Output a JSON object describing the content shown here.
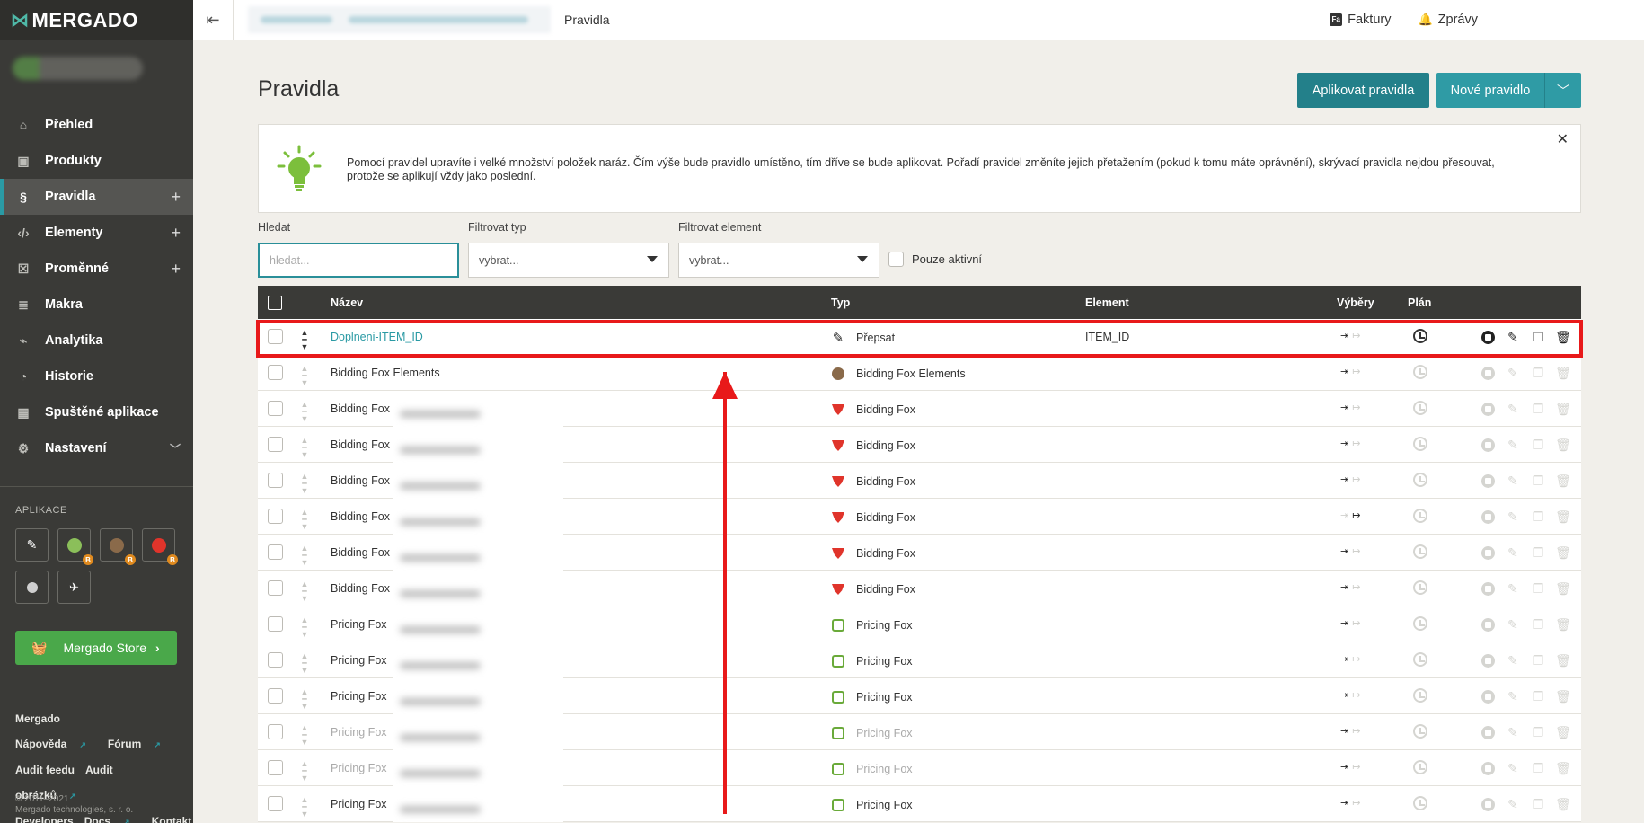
{
  "brand": {
    "logo_text": "MERGADO"
  },
  "sidebar": {
    "items": [
      {
        "label": "Přehled",
        "icon": "home-icon"
      },
      {
        "label": "Produkty",
        "icon": "box-icon"
      },
      {
        "label": "Pravidla",
        "icon": "section-icon",
        "active": true,
        "plus": "+"
      },
      {
        "label": "Elementy",
        "icon": "code-icon",
        "plus": "+"
      },
      {
        "label": "Proměnné",
        "icon": "variable-icon",
        "plus": "+"
      },
      {
        "label": "Makra",
        "icon": "macro-icon"
      },
      {
        "label": "Analytika",
        "icon": "chart-icon"
      },
      {
        "label": "Historie",
        "icon": "history-icon"
      },
      {
        "label": "Spuštěné aplikace",
        "icon": "apps-grid-icon"
      },
      {
        "label": "Nastavení",
        "icon": "gear-icon"
      }
    ],
    "apps_title": "APLIKACE",
    "store_label": "Mergado Store",
    "footer": {
      "mergado": "Mergado",
      "napoveda": "Nápověda",
      "forum": "Fórum",
      "audit_feedu": "Audit feedu",
      "audit_obrazku": "Audit obrázků",
      "developers": "Developers",
      "docs": "Docs",
      "kontakt": "Kontakt",
      "copy1": "© 2011–2021",
      "copy2": "Mergado technologies, s. r. o."
    }
  },
  "topbar": {
    "title": "Pravidla",
    "faktury": "Faktury",
    "zpravy": "Zprávy",
    "faktury_icon_text": "Fa"
  },
  "page": {
    "title": "Pravidla",
    "apply_button": "Aplikovat pravidla",
    "new_button": "Nové pravidlo",
    "info_text": "Pomocí pravidel upravíte i velké množství položek naráz. Čím výše bude pravidlo umístěno, tím dříve se bude aplikovat. Pořadí pravidel změníte jejich přetažením (pokud k tomu máte oprávnění), skrývací pravidla nejdou přesouvat, protože se aplikují vždy jako poslední."
  },
  "filters": {
    "search_label": "Hledat",
    "search_placeholder": "hledat...",
    "type_label": "Filtrovat typ",
    "type_value": "vybrat...",
    "element_label": "Filtrovat element",
    "element_value": "vybrat...",
    "only_active": "Pouze aktivní"
  },
  "table": {
    "headers": {
      "name": "Název",
      "type": "Typ",
      "element": "Element",
      "selections": "Výběry",
      "plan": "Plán"
    },
    "rows": [
      {
        "name": "Doplneni-ITEM_ID",
        "type": "Přepsat",
        "type_icon": "pencil-icon",
        "element": "ITEM_ID"
      },
      {
        "name": "Bidding Fox Elements",
        "type": "Bidding Fox Elements",
        "type_icon": "fox-icon",
        "element": ""
      },
      {
        "name": "Bidding Fox",
        "type": "Bidding Fox",
        "type_icon": "bidding-fox-icon",
        "element": ""
      },
      {
        "name": "Bidding Fox",
        "type": "Bidding Fox",
        "type_icon": "bidding-fox-icon",
        "element": ""
      },
      {
        "name": "Bidding Fox",
        "type": "Bidding Fox",
        "type_icon": "bidding-fox-icon",
        "element": ""
      },
      {
        "name": "Bidding Fox",
        "type": "Bidding Fox",
        "type_icon": "bidding-fox-icon",
        "element": ""
      },
      {
        "name": "Bidding Fox",
        "type": "Bidding Fox",
        "type_icon": "bidding-fox-icon",
        "element": ""
      },
      {
        "name": "Bidding Fox",
        "type": "Bidding Fox",
        "type_icon": "bidding-fox-icon",
        "element": ""
      },
      {
        "name": "Pricing Fox",
        "type": "Pricing Fox",
        "type_icon": "pricing-fox-icon",
        "element": ""
      },
      {
        "name": "Pricing Fox",
        "type": "Pricing Fox",
        "type_icon": "pricing-fox-icon",
        "element": ""
      },
      {
        "name": "Pricing Fox",
        "type": "Pricing Fox",
        "type_icon": "pricing-fox-icon",
        "element": ""
      },
      {
        "name": "Pricing Fox",
        "type": "Pricing Fox",
        "type_icon": "pricing-fox-icon",
        "element": ""
      },
      {
        "name": "Pricing Fox",
        "type": "Pricing Fox",
        "type_icon": "pricing-fox-icon",
        "element": ""
      },
      {
        "name": "Pricing Fox",
        "type": "Pricing Fox",
        "type_icon": "pricing-fox-icon",
        "element": ""
      }
    ]
  },
  "colors": {
    "accent": "#2a9aa4",
    "highlight": "#e8191a",
    "store": "#4aa84a"
  }
}
